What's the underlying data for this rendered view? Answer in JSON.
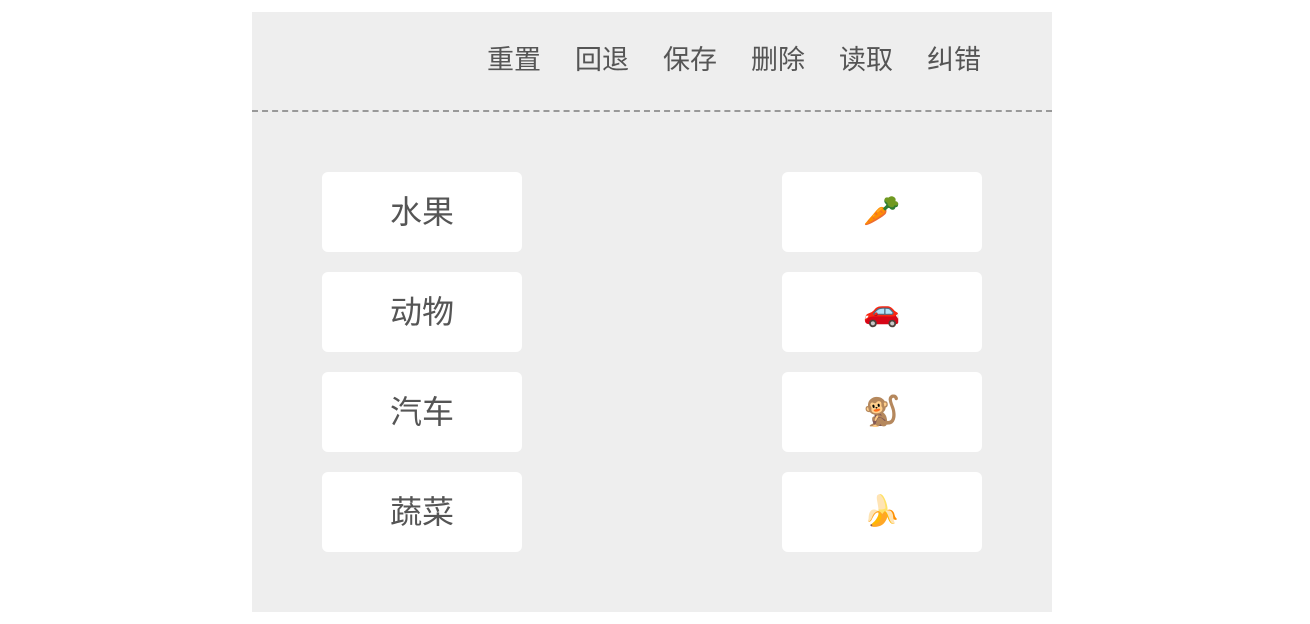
{
  "toolbar": {
    "reset_label": "重置",
    "undo_label": "回退",
    "save_label": "保存",
    "delete_label": "删除",
    "load_label": "读取",
    "check_label": "纠错"
  },
  "categories": [
    {
      "label": "水果"
    },
    {
      "label": "动物"
    },
    {
      "label": "汽车"
    },
    {
      "label": "蔬菜"
    }
  ],
  "items": [
    {
      "icon": "carrot-icon",
      "glyph": "🥕"
    },
    {
      "icon": "car-icon",
      "glyph": "🚗"
    },
    {
      "icon": "monkey-icon",
      "glyph": "🐒"
    },
    {
      "icon": "banana-icon",
      "glyph": "🍌"
    }
  ],
  "colors": {
    "background": "#eeeeee",
    "card": "#ffffff",
    "text": "#555555",
    "divider": "#999999"
  }
}
